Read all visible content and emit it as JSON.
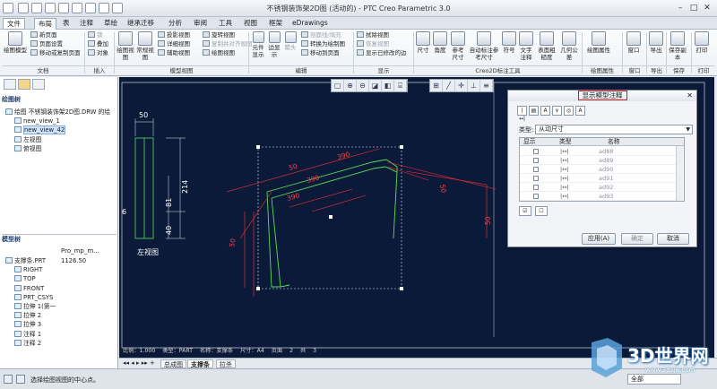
{
  "titlebar": {
    "title": "不锈钢装饰架2D图 (活动的) - PTC Creo Parametric 3.0"
  },
  "tabs": [
    "文件",
    "布局",
    "表",
    "注释",
    "草绘",
    "继承迁移",
    "分析",
    "审阅",
    "工具",
    "视图",
    "框架",
    "eDrawings"
  ],
  "ribbon": {
    "doc_group": {
      "big": "绘图模型",
      "small": [
        "新页面",
        "页面设置",
        "移动或复制页面"
      ],
      "label": "文档"
    },
    "insert_group": {
      "items": [
        "锁",
        "叠加",
        "对象"
      ],
      "label": "插入"
    },
    "model_views": {
      "big": [
        "绘图视图",
        "常规视图"
      ],
      "small": [
        "投影视图",
        "详细视图",
        "辅助视图",
        "旋转视图",
        "复制并对齐视图",
        "绘图视图"
      ],
      "label": "模型视图"
    },
    "edit": {
      "big": [
        "元件显示",
        "边显示",
        "箭头"
      ],
      "small": [
        "剖面线/填充",
        "转换为绘制图",
        "移动到页面"
      ],
      "label": "编辑"
    },
    "display": {
      "small": [
        "拭除视图",
        "恢复视图",
        "显示已修改的边"
      ],
      "label": "显示"
    },
    "creo2d": {
      "big": [
        "尺寸",
        "角度",
        "参考尺寸",
        "自动标注参考尺寸",
        "符号",
        "文字注释",
        "表面粗糙度",
        "几何公差"
      ],
      "label": "Creo2D标注工具"
    },
    "props": {
      "big": [
        "绘图属性"
      ],
      "label": "绘图属性"
    },
    "window": {
      "big": [
        "窗口"
      ],
      "label": "窗口"
    },
    "export": {
      "big": [
        "导出"
      ],
      "label": "导出"
    },
    "save": {
      "big": [
        "保存副本"
      ],
      "label": "保存"
    },
    "print": {
      "big": [
        "打印"
      ],
      "label": "打印"
    }
  },
  "drawing_tree": {
    "header": "绘图树",
    "items": [
      "绘图 不锈钢装饰架2D图.DRW 的绘",
      "new_view_1",
      "new_view_42",
      "左视图",
      "俯视图"
    ],
    "selected_index": 2
  },
  "model_tree": {
    "header": "模型树",
    "columns": [
      "",
      "Pro_mp_m..."
    ],
    "items": [
      {
        "name": "支撑条.PRT",
        "value": "1126.50"
      },
      {
        "name": "RIGHT",
        "value": ""
      },
      {
        "name": "TOP",
        "value": ""
      },
      {
        "name": "FRONT",
        "value": ""
      },
      {
        "name": "PRT_CSYS",
        "value": ""
      },
      {
        "name": "拉伸 1(第一",
        "value": ""
      },
      {
        "name": "拉伸 2",
        "value": ""
      },
      {
        "name": "拉伸 3",
        "value": ""
      },
      {
        "name": "注释 1",
        "value": ""
      },
      {
        "name": "注释 2",
        "value": ""
      }
    ]
  },
  "canvas": {
    "left_view_label": "左视图",
    "status": "比例：1.000  类型：PART  名称：支撑条  尺寸：A4  页面 2 共 3",
    "dims_left": [
      "50",
      "214",
      "81",
      "40",
      "6"
    ],
    "dims_iso": [
      "50",
      "390",
      "390",
      "50",
      "50",
      "50",
      "390"
    ]
  },
  "dialog": {
    "title": "显示模型注释",
    "type_label": "类型:",
    "type_value": "从动尺寸",
    "columns": [
      "显示",
      "类型",
      "名称"
    ],
    "rows": [
      {
        "type": "|↔|",
        "name": "ad88"
      },
      {
        "type": "|↔|",
        "name": "ad89"
      },
      {
        "type": "|↔|",
        "name": "ad90"
      },
      {
        "type": "|↔|",
        "name": "ad91"
      },
      {
        "type": "|↔|",
        "name": "ad92"
      },
      {
        "type": "|↔|",
        "name": "ad93"
      }
    ],
    "buttons": {
      "apply": "应用(A)",
      "ok": "确定",
      "cancel": "取消"
    }
  },
  "page_tabs": [
    "总成图",
    "支撑条",
    "拉杀"
  ],
  "active_page": 1,
  "statusbar": {
    "message": "选择绘图视图的中心点。",
    "filter": "全部"
  },
  "watermark": {
    "text": "3D世界网",
    "url": "www.3dsjw.com"
  }
}
